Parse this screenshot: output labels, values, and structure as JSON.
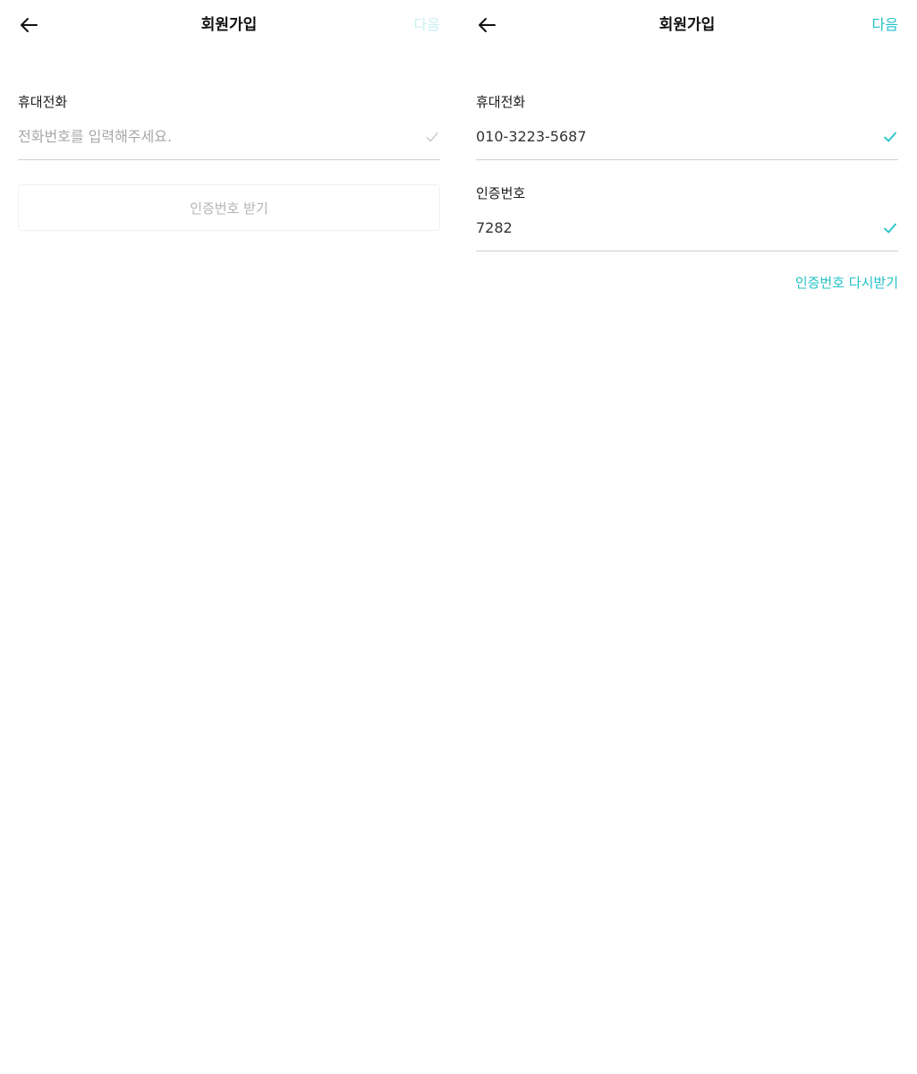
{
  "colors": {
    "accent": "#22c1c8",
    "accent_disabled": "#c9eef0",
    "divider": "#cfcfcf",
    "placeholder": "#a8a8a8",
    "check_inactive": "#c8c8c8"
  },
  "screen1": {
    "header": {
      "back_icon": "arrow-left-icon",
      "title": "회원가입",
      "next_label": "다음",
      "next_state": "disabled"
    },
    "phone_field": {
      "label": "휴대전화",
      "value": "",
      "placeholder": "전화번호를 입력해주세요.",
      "check_icon": "check-icon",
      "check_state": "inactive"
    },
    "verify_button": {
      "label": "인증번호 받기"
    }
  },
  "screen2": {
    "header": {
      "back_icon": "arrow-left-icon",
      "title": "회원가입",
      "next_label": "다음",
      "next_state": "enabled"
    },
    "phone_field": {
      "label": "휴대전화",
      "value": "010-3223-5687",
      "check_icon": "check-icon",
      "check_state": "active"
    },
    "code_field": {
      "label": "인증번호",
      "value": "7282",
      "check_icon": "check-icon",
      "check_state": "active"
    },
    "resend_link": {
      "label": "인증번호 다시받기"
    }
  }
}
